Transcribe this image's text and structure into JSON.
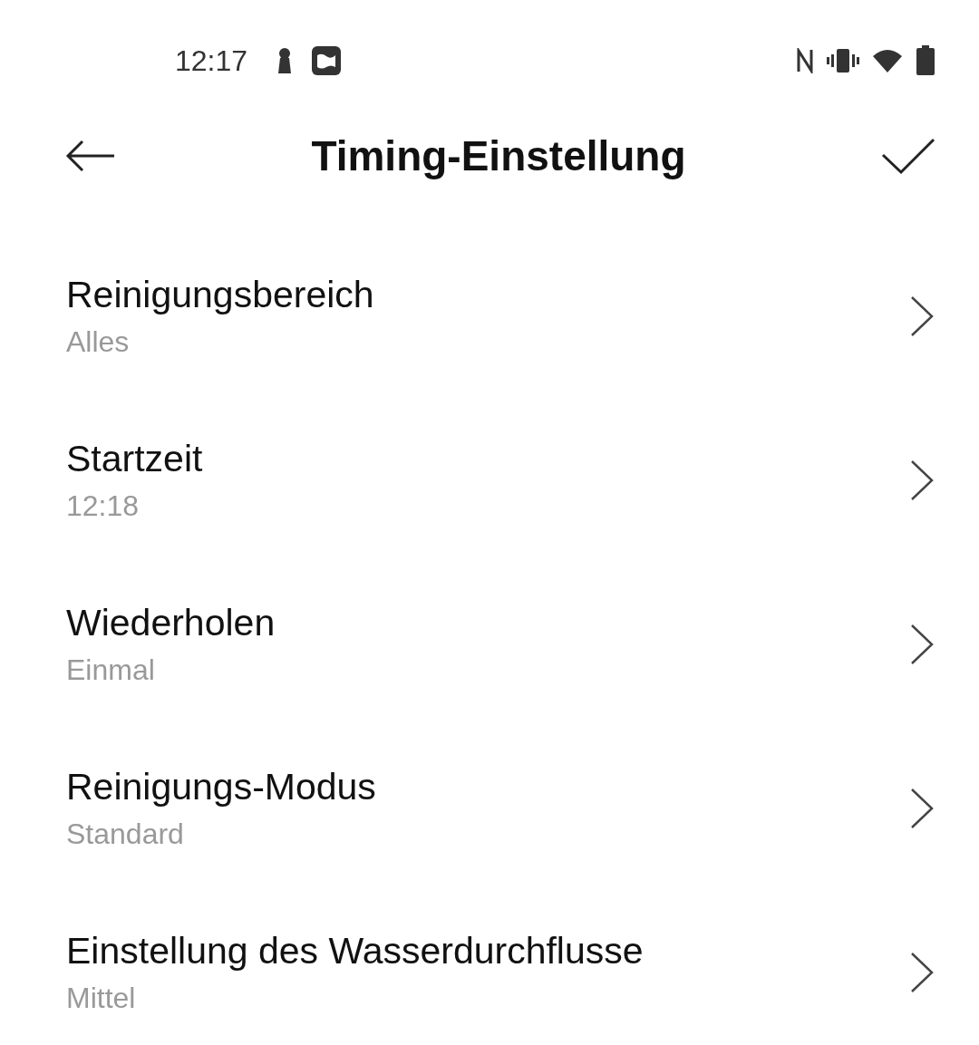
{
  "status_bar": {
    "time": "12:17"
  },
  "header": {
    "title": "Timing-Einstellung"
  },
  "settings": [
    {
      "label": "Reinigungsbereich",
      "value": "Alles"
    },
    {
      "label": "Startzeit",
      "value": "12:18"
    },
    {
      "label": "Wiederholen",
      "value": "Einmal"
    },
    {
      "label": "Reinigungs-Modus",
      "value": "Standard"
    },
    {
      "label": "Einstellung des Wasserdurchflusse",
      "value": "Mittel"
    }
  ]
}
